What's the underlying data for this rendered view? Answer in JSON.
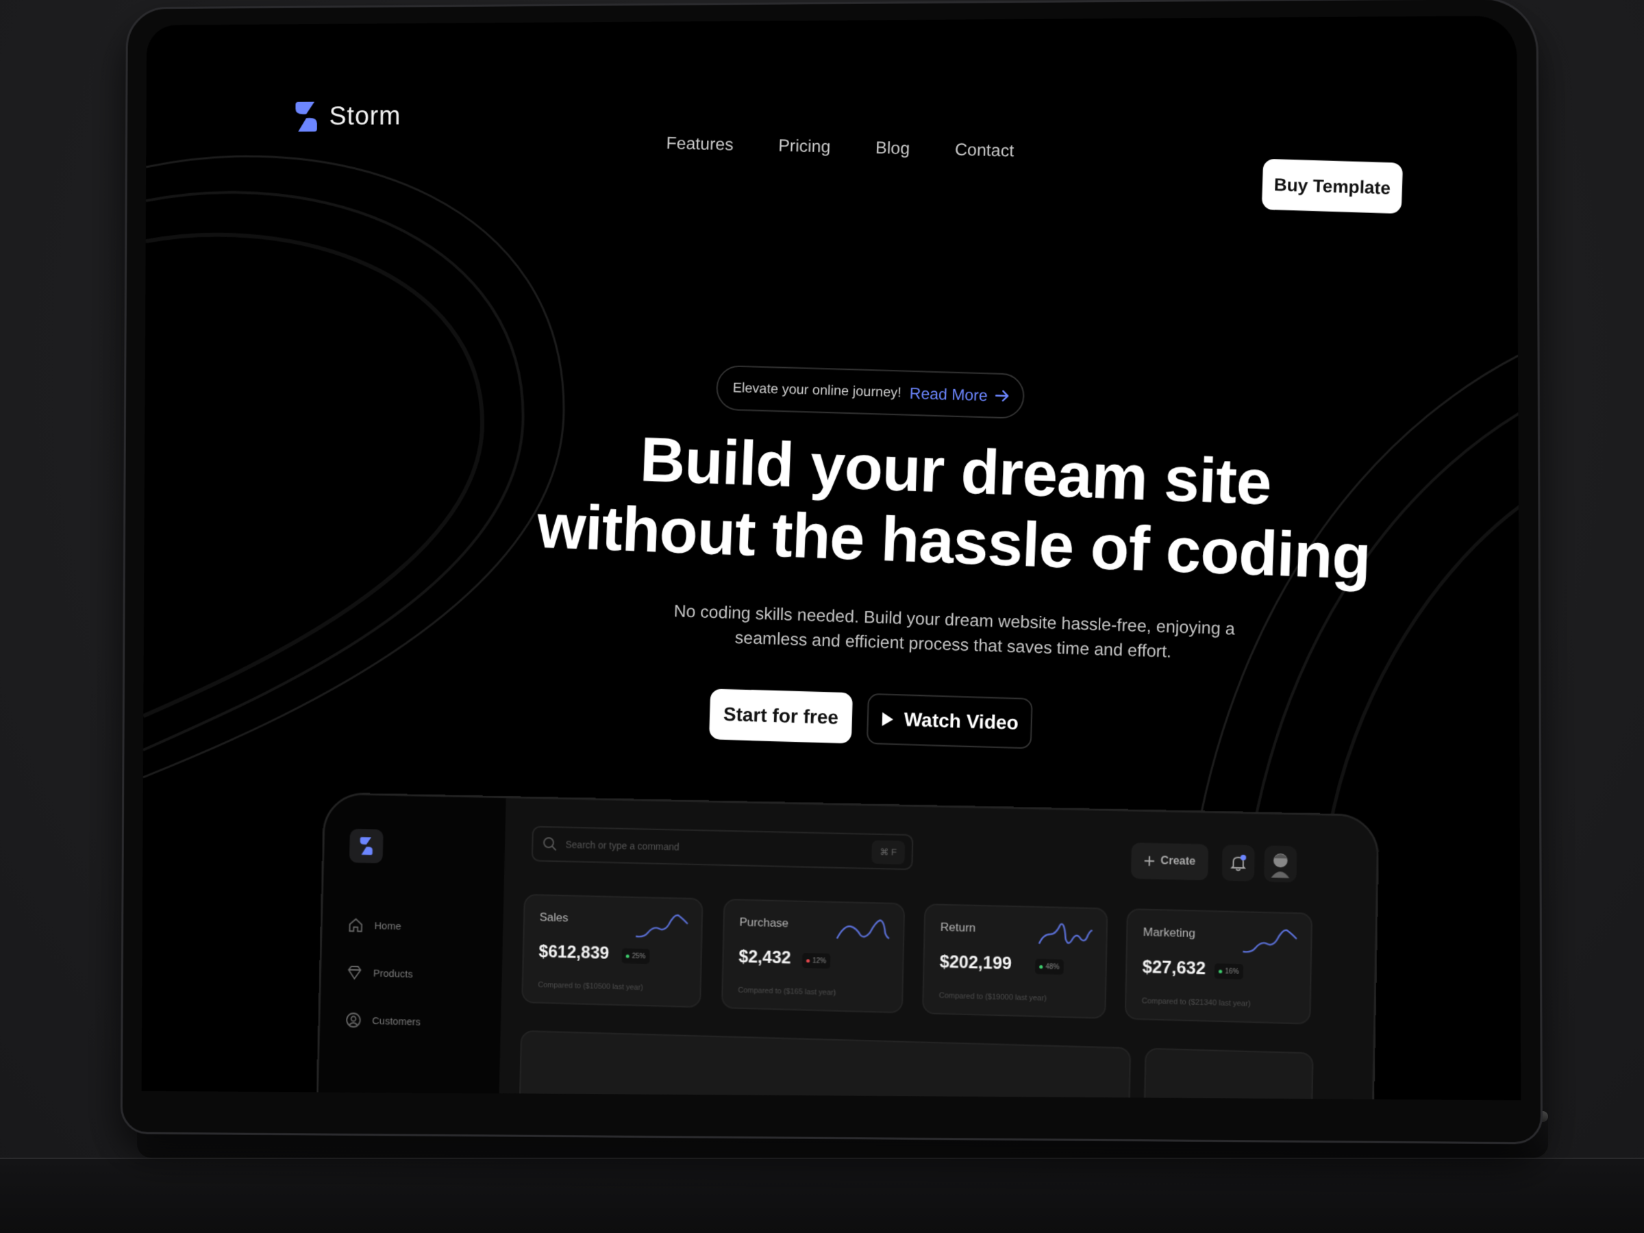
{
  "brand": {
    "name": "Storm",
    "accent": "#6c86ff"
  },
  "nav": {
    "links": [
      {
        "label": "Features"
      },
      {
        "label": "Pricing"
      },
      {
        "label": "Blog"
      },
      {
        "label": "Contact"
      }
    ],
    "cta_label": "Buy Template"
  },
  "hero": {
    "announcement": {
      "text": "Elevate your online journey!",
      "link_label": "Read More",
      "link_icon": "arrow-right-icon"
    },
    "title_line1": "Build your dream site",
    "title_line2": "without the hassle of coding",
    "subtitle": "No coding skills needed. Build your dream website hassle-free, enjoying a seamless and efficient process that saves time and effort.",
    "primary_button": "Start for free",
    "secondary_button": "Watch Video",
    "secondary_icon": "play-icon"
  },
  "dashboard": {
    "sidebar": [
      {
        "label": "Home",
        "icon": "home-icon"
      },
      {
        "label": "Products",
        "icon": "gem-icon"
      },
      {
        "label": "Customers",
        "icon": "user-circle-icon"
      }
    ],
    "search": {
      "placeholder": "Search or type a command",
      "shortcut": "⌘ F"
    },
    "create_label": "Create",
    "notification_dot_color": "#6c86ff",
    "stats": [
      {
        "label": "Sales",
        "value": "$612,839",
        "change": "25%",
        "trend": "up",
        "compare": "Compared to ($10500 last year)"
      },
      {
        "label": "Purchase",
        "value": "$2,432",
        "change": "12%",
        "trend": "down",
        "compare": "Compared to ($165 last year)"
      },
      {
        "label": "Return",
        "value": "$202,199",
        "change": "48%",
        "trend": "up",
        "compare": "Compared to ($19000 last year)"
      },
      {
        "label": "Marketing",
        "value": "$27,632",
        "change": "16%",
        "trend": "up",
        "compare": "Compared to ($21340 last year)"
      }
    ],
    "colors": {
      "up": "#3ecf6e",
      "down": "#e5484d",
      "sparkline": "#5a6fd6"
    }
  }
}
